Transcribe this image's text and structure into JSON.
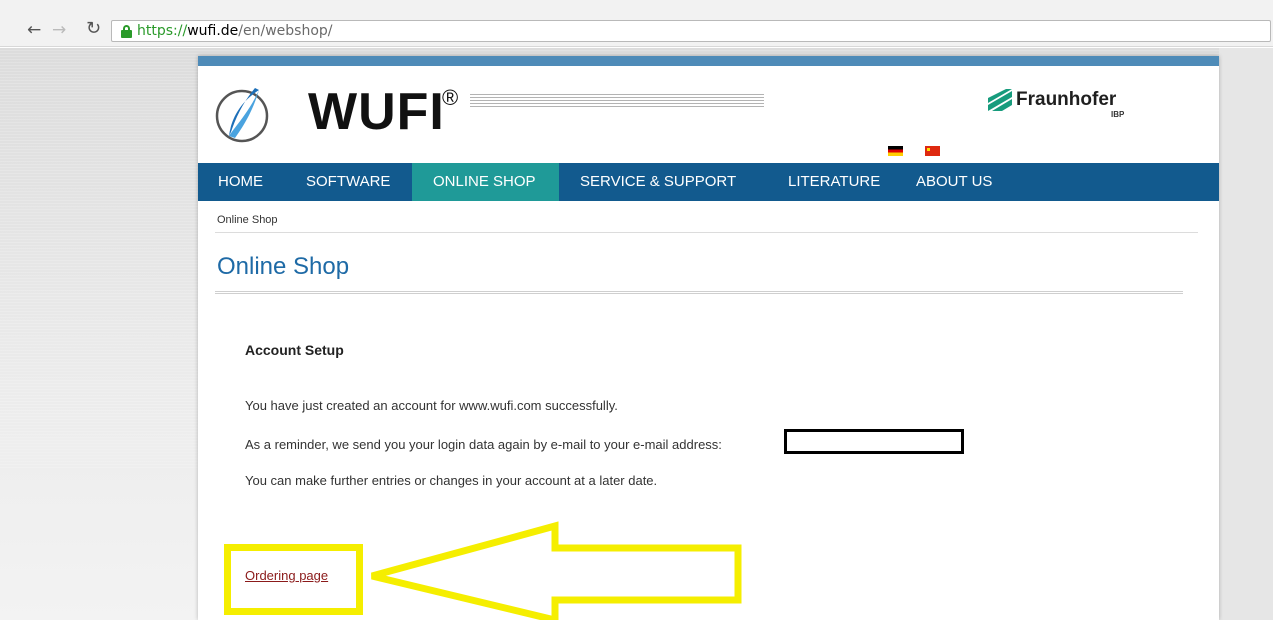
{
  "browser": {
    "url_scheme": "https://",
    "url_host": "wufi.de",
    "url_path": "/en/webshop/",
    "icons": [
      "back-arrow-icon",
      "forward-arrow-icon",
      "reload-icon",
      "lock-icon"
    ]
  },
  "header": {
    "logo_text": "WUFI",
    "logo_mark": "®",
    "partner_name": "Fraunhofer",
    "partner_sub": "IBP",
    "flags": [
      "german-flag-icon",
      "chinese-flag-icon"
    ]
  },
  "nav": {
    "items": [
      {
        "label": "HOME"
      },
      {
        "label": "SOFTWARE"
      },
      {
        "label": "ONLINE SHOP",
        "active": true
      },
      {
        "label": "SERVICE & SUPPORT"
      },
      {
        "label": "LITERATURE"
      },
      {
        "label": "ABOUT US"
      }
    ]
  },
  "content": {
    "breadcrumb": "Online Shop",
    "page_title": "Online Shop",
    "section_title": "Account Setup",
    "line1": "You have just created an account for www.wufi.com successfully.",
    "line2": "As a reminder, we send you your login data again by e-mail to your e-mail address:",
    "line3": "You can make further entries or changes in your account at a later date.",
    "ordering_link": "Ordering page"
  },
  "colors": {
    "nav_bg": "#125a8e",
    "nav_active": "#1f9a98",
    "title": "#1e6aa6",
    "highlight": "#f5ee00",
    "link": "#8b1a1a"
  }
}
